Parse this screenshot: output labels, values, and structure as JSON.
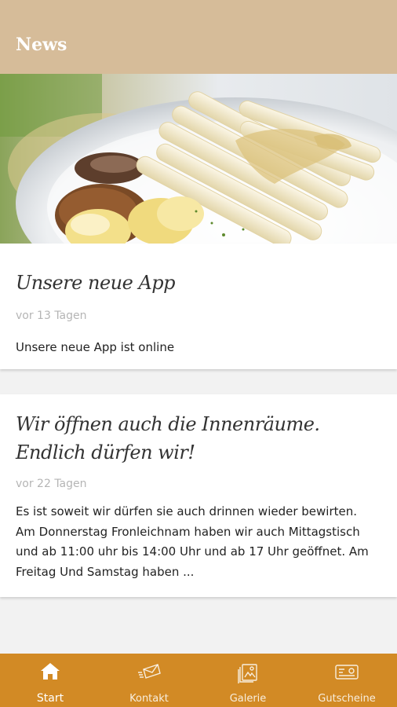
{
  "appbar": {
    "title": "News"
  },
  "hero": {
    "image": "asparagus-dish-photo"
  },
  "news": [
    {
      "title": "Unsere neue App",
      "date": "vor 13 Tagen",
      "text": "Unsere neue App ist online"
    },
    {
      "title": "Wir öffnen auch die Innenräume. Endlich dürfen wir!",
      "date": "vor 22 Tagen",
      "text": "Es ist soweit wir dürfen sie auch drinnen wieder bewirten. Am Donnerstag Fronleichnam haben wir auch Mittagstisch und ab 11:00 uhr bis 14:00 Uhr und ab 17 Uhr geöffnet. Am Freitag Und Samstag haben ..."
    }
  ],
  "nav": {
    "items": [
      {
        "label": "Start",
        "icon": "home-icon",
        "active": true
      },
      {
        "label": "Kontakt",
        "icon": "envelope-icon",
        "active": false
      },
      {
        "label": "Galerie",
        "icon": "gallery-icon",
        "active": false
      },
      {
        "label": "Gutscheine",
        "icon": "voucher-icon",
        "active": false
      }
    ]
  },
  "colors": {
    "appbar": "#d6bc99",
    "navbar": "#d28a25",
    "background": "#f2f2f2"
  }
}
